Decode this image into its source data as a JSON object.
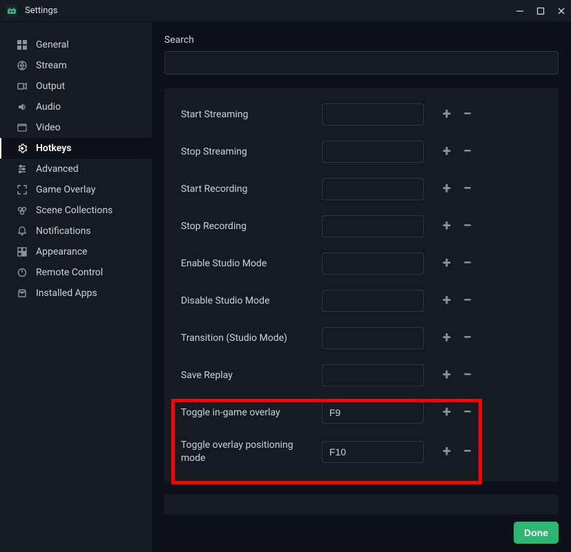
{
  "titlebar": {
    "title": "Settings"
  },
  "sidebar": {
    "items": [
      {
        "label": "General"
      },
      {
        "label": "Stream"
      },
      {
        "label": "Output"
      },
      {
        "label": "Audio"
      },
      {
        "label": "Video"
      },
      {
        "label": "Hotkeys"
      },
      {
        "label": "Advanced"
      },
      {
        "label": "Game Overlay"
      },
      {
        "label": "Scene Collections"
      },
      {
        "label": "Notifications"
      },
      {
        "label": "Appearance"
      },
      {
        "label": "Remote Control"
      },
      {
        "label": "Installed Apps"
      }
    ]
  },
  "search": {
    "label": "Search",
    "value": ""
  },
  "hotkeys": [
    {
      "label": "Start Streaming",
      "value": ""
    },
    {
      "label": "Stop Streaming",
      "value": ""
    },
    {
      "label": "Start Recording",
      "value": ""
    },
    {
      "label": "Stop Recording",
      "value": ""
    },
    {
      "label": "Enable Studio Mode",
      "value": ""
    },
    {
      "label": "Disable Studio Mode",
      "value": ""
    },
    {
      "label": "Transition (Studio Mode)",
      "value": ""
    },
    {
      "label": "Save Replay",
      "value": ""
    },
    {
      "label": "Toggle in-game overlay",
      "value": "F9"
    },
    {
      "label": "Toggle overlay positioning mode",
      "value": "F10"
    }
  ],
  "footer": {
    "done": "Done"
  }
}
